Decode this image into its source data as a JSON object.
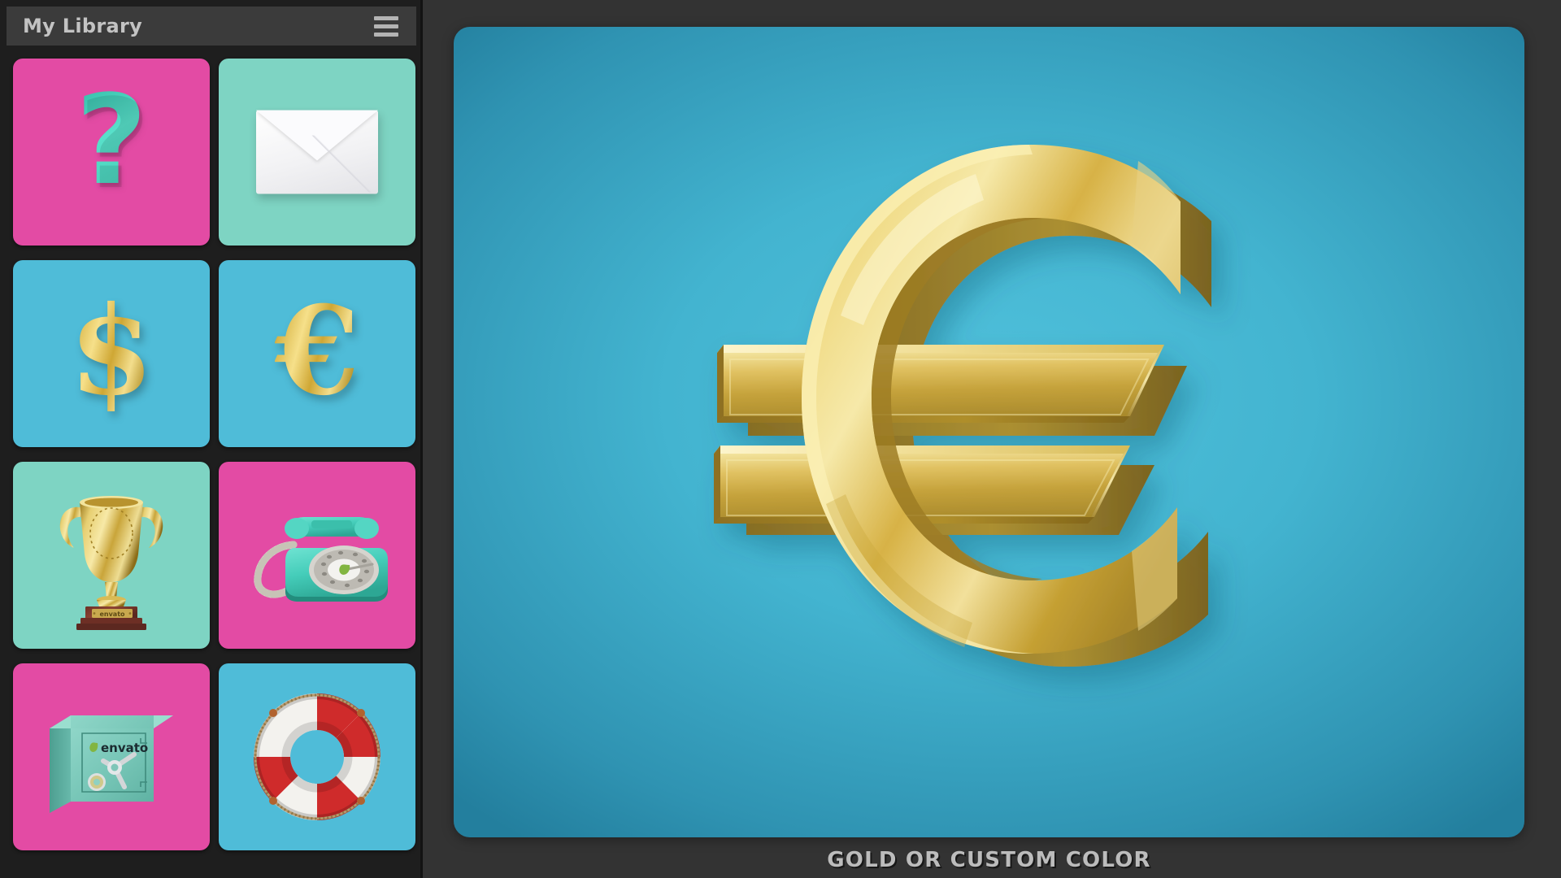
{
  "sidebar": {
    "title": "My Library",
    "menu_icon": "hamburger-menu-icon",
    "items": [
      {
        "id": "question-mark",
        "name": "question-mark-thumbnail",
        "bg_color": "#e34ba4",
        "glyph": "?",
        "alt": "3D teal question mark on pink background"
      },
      {
        "id": "envelope",
        "name": "envelope-thumbnail",
        "bg_color": "#7ed4c3",
        "glyph": "",
        "alt": "White envelope on mint background"
      },
      {
        "id": "dollar-sign",
        "name": "dollar-sign-thumbnail",
        "bg_color": "#4fbcd8",
        "glyph": "$",
        "alt": "3D gold dollar sign on cyan background"
      },
      {
        "id": "euro-sign",
        "name": "euro-sign-thumbnail",
        "bg_color": "#4fbcd8",
        "glyph": "€",
        "alt": "3D gold euro sign on cyan background"
      },
      {
        "id": "trophy",
        "name": "trophy-thumbnail",
        "bg_color": "#7ed4c3",
        "glyph": "",
        "alt": "Gold trophy with envato nameplate on mint background",
        "label": "envato"
      },
      {
        "id": "telephone",
        "name": "telephone-thumbnail",
        "bg_color": "#e34ba4",
        "glyph": "",
        "alt": "Retro teal rotary telephone on pink background"
      },
      {
        "id": "safe",
        "name": "safe-thumbnail",
        "bg_color": "#e34ba4",
        "glyph": "",
        "alt": "Teal safe with envato logo on pink background",
        "label": "envato"
      },
      {
        "id": "life-ring",
        "name": "life-ring-thumbnail",
        "bg_color": "#4fbcd8",
        "glyph": "",
        "alt": "Red and white life preserver ring on cyan background"
      }
    ]
  },
  "preview": {
    "caption": "GOLD OR CUSTOM COLOR",
    "subject": "euro-sign",
    "background_color": "#43b4d0",
    "gold_color": "#e0c35c"
  },
  "colors": {
    "app_background": "#333333",
    "sidebar_background": "#1e1e1e",
    "header_background": "#3b3b3b",
    "title_text": "#c3c3c3",
    "caption_text": "#bcbcbc",
    "pink": "#e34ba4",
    "mint": "#7ed4c3",
    "cyan": "#4fbcd8",
    "gold": "#e0c35c",
    "envato_green": "#82b541"
  }
}
